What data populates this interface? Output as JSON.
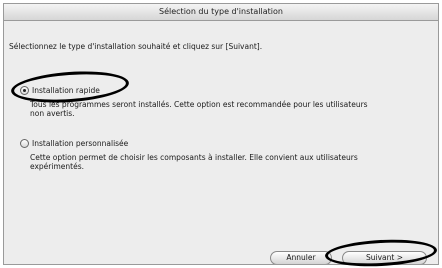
{
  "window": {
    "title": "Sélection du type d'installation"
  },
  "instruction": "Sélectionnez le type d'installation souhaité et cliquez sur [Suivant].",
  "options": [
    {
      "label": "Installation rapide",
      "selected": true,
      "description_line1": "Tous les programmes seront installés. Cette option est recommandée pour les utilisateurs",
      "description_line2": "non avertis."
    },
    {
      "label": "Installation personnalisée",
      "selected": false,
      "description_line1": "Cette option permet de choisir les composants à installer. Elle convient aux utilisateurs",
      "description_line2": "expérimentés."
    }
  ],
  "buttons": {
    "cancel": "Annuler",
    "next": "Suivant >"
  }
}
